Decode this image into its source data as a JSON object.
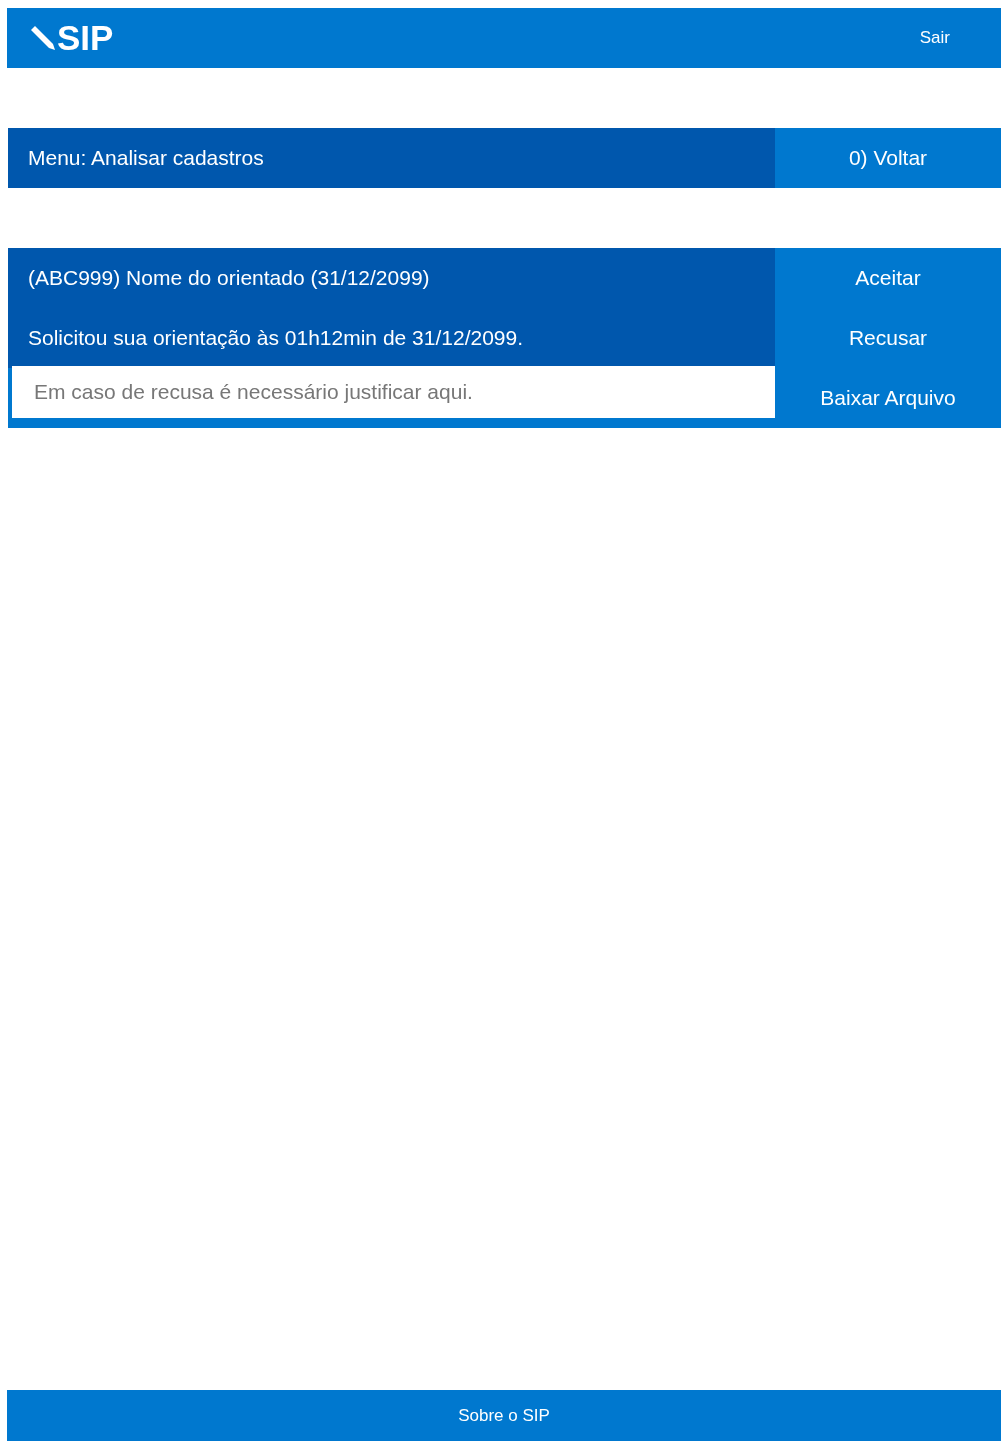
{
  "header": {
    "logo": "SIP",
    "logout": "Sair"
  },
  "menu": {
    "title": "Menu: Analisar cadastros",
    "back": "0) Voltar"
  },
  "request": {
    "title": "(ABC999) Nome do orientado (31/12/2099)",
    "message": "Solicitou sua orientação às 01h12min de 31/12/2099.",
    "justification": {
      "placeholder": "Em caso de recusa é necessário justificar aqui."
    },
    "actions": [
      "Aceitar",
      "Recusar",
      "Baixar Arquivo"
    ]
  },
  "footer": {
    "link": "Sobre o SIP"
  }
}
